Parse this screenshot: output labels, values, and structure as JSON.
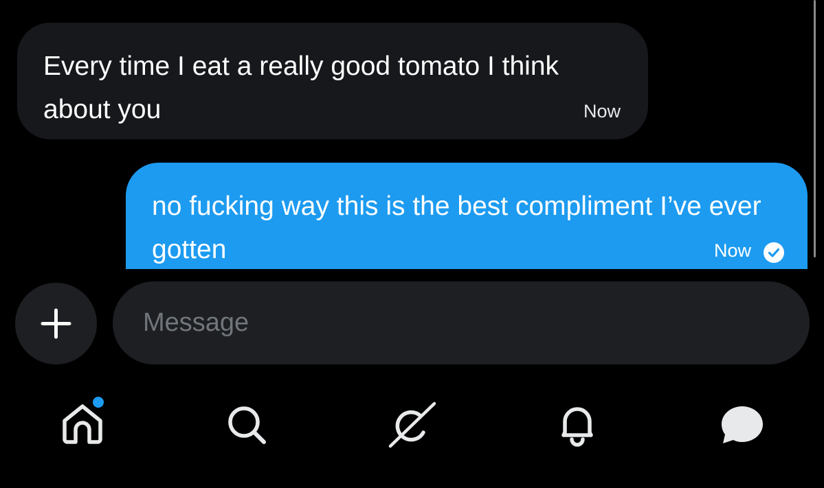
{
  "conversation": {
    "messages": [
      {
        "direction": "received",
        "text": "Every time I eat a really good tomato I think about you",
        "time": "Now"
      },
      {
        "direction": "sent",
        "text": "no fucking way this is the best compliment I’ve ever gotten",
        "time": "Now",
        "status_icon": "check-circle-icon"
      }
    ]
  },
  "composer": {
    "add_icon": "plus-icon",
    "placeholder": "Message"
  },
  "bottom_nav": {
    "items": [
      {
        "icon": "home-icon",
        "unread_dot": true
      },
      {
        "icon": "search-icon"
      },
      {
        "icon": "grok-icon"
      },
      {
        "icon": "bell-icon"
      },
      {
        "icon": "messages-icon"
      }
    ]
  },
  "colors": {
    "background": "#000000",
    "received_bubble": "#16181c",
    "sent_bubble": "#1d9bf0",
    "input_background": "#1d1f23",
    "placeholder": "#71767b",
    "accent": "#1d9bf0"
  }
}
